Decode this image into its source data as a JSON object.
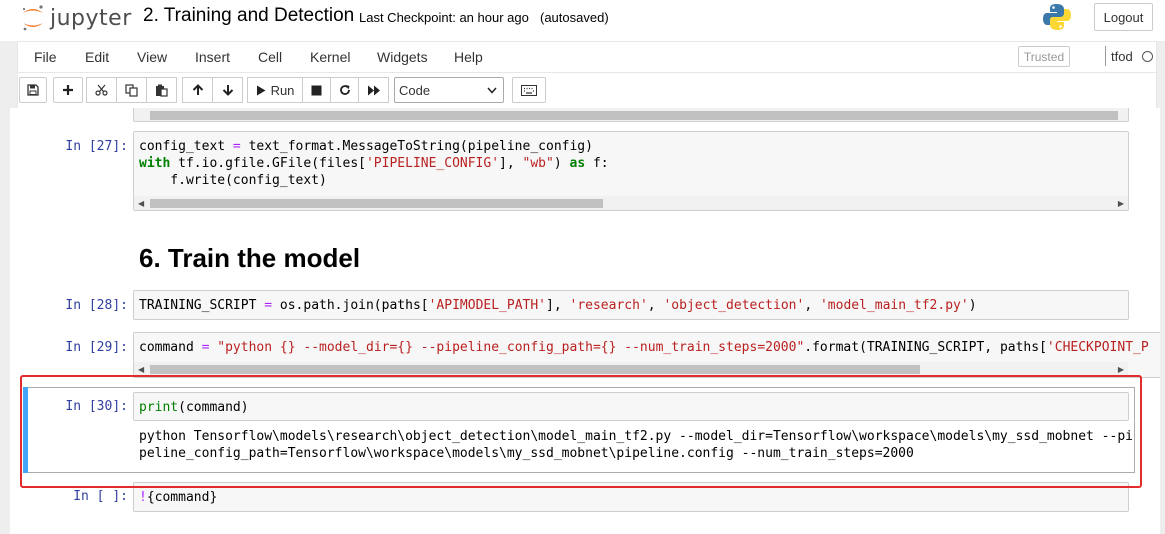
{
  "header": {
    "logo_text": "jupyter",
    "notebook_title": "2. Training and Detection",
    "checkpoint": "Last Checkpoint: an hour ago",
    "autosave": "(autosaved)",
    "logout_label": "Logout"
  },
  "menu": {
    "items": [
      "File",
      "Edit",
      "View",
      "Insert",
      "Cell",
      "Kernel",
      "Widgets",
      "Help"
    ],
    "trusted_label": "Trusted",
    "kernel_name": "tfod"
  },
  "toolbar": {
    "run_label": "Run",
    "cell_type": "Code",
    "icons": [
      "save-icon",
      "plus-icon",
      "cut-icon",
      "copy-icon",
      "paste-icon",
      "arrow-up-icon",
      "arrow-down-icon",
      "play-icon",
      "stop-icon",
      "restart-icon",
      "fast-forward-icon",
      "keyboard-icon"
    ]
  },
  "cells": {
    "c27": {
      "prompt": "In [27]:",
      "line1_a": "config_text ",
      "line1_op": "=",
      "line1_b": " text_format.MessageToString(pipeline_config)",
      "line2_kw": "with",
      "line2_a": " tf.io.gfile.GFile(files[",
      "line2_s1": "'PIPELINE_CONFIG'",
      "line2_b": "], ",
      "line2_s2": "\"wb\"",
      "line2_c": ") ",
      "line2_kw2": "as",
      "line2_d": " f:",
      "line3": "    f.write(config_text)"
    },
    "heading": "6. Train the model",
    "c28": {
      "prompt": "In [28]:",
      "a": "TRAINING_SCRIPT ",
      "op": "=",
      "b": " os.path.join(paths[",
      "s1": "'APIMODEL_PATH'",
      "c": "], ",
      "s2": "'research'",
      "d": ", ",
      "s3": "'object_detection'",
      "e": ", ",
      "s4": "'model_main_tf2.py'",
      "f": ")"
    },
    "c29": {
      "prompt": "In [29]:",
      "a": "command ",
      "op": "=",
      "s1": " \"python {} --model_dir={} --pipeline_config_path={} --num_train_steps=2000\"",
      "b": ".format(TRAINING_SCRIPT, paths[",
      "s2": "'CHECKPOINT_P"
    },
    "c30": {
      "prompt": "In [30]:",
      "fn": "print",
      "rest": "(command)",
      "output_line1": "python Tensorflow\\models\\research\\object_detection\\model_main_tf2.py --model_dir=Tensorflow\\workspace\\models\\my_ssd_mobnet --pi",
      "output_line2": "peline_config_path=Tensorflow\\workspace\\models\\my_ssd_mobnet\\pipeline.config --num_train_steps=2000"
    },
    "c_empty": {
      "prompt": "In [ ]:",
      "op": "!",
      "rest": "{command}"
    }
  },
  "colors": {
    "prompt": "#303f9f",
    "keyword": "#008000",
    "string": "#ba2121",
    "operator": "#aa22ff",
    "selected_bar": "#42a5f5",
    "highlight_border": "#e32b2b"
  }
}
